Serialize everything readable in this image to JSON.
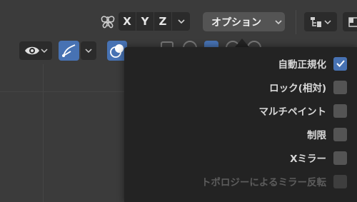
{
  "header": {
    "axes": [
      "X",
      "Y",
      "Z"
    ],
    "options_label": "オプション"
  },
  "dropdown": {
    "items": [
      {
        "label": "自動正規化",
        "checked": true,
        "enabled": true
      },
      {
        "label": "ロック(相対)",
        "checked": false,
        "enabled": true
      },
      {
        "label": "マルチペイント",
        "checked": false,
        "enabled": true
      },
      {
        "label": "制限",
        "checked": false,
        "enabled": true
      },
      {
        "label": "Xミラー",
        "checked": false,
        "enabled": true
      },
      {
        "label": "トポロジーによるミラー反転",
        "checked": false,
        "enabled": false
      }
    ]
  },
  "colors": {
    "accent": "#4772b3",
    "panel": "#232323",
    "button": "#545454",
    "viewport": "#3b3b3b"
  }
}
